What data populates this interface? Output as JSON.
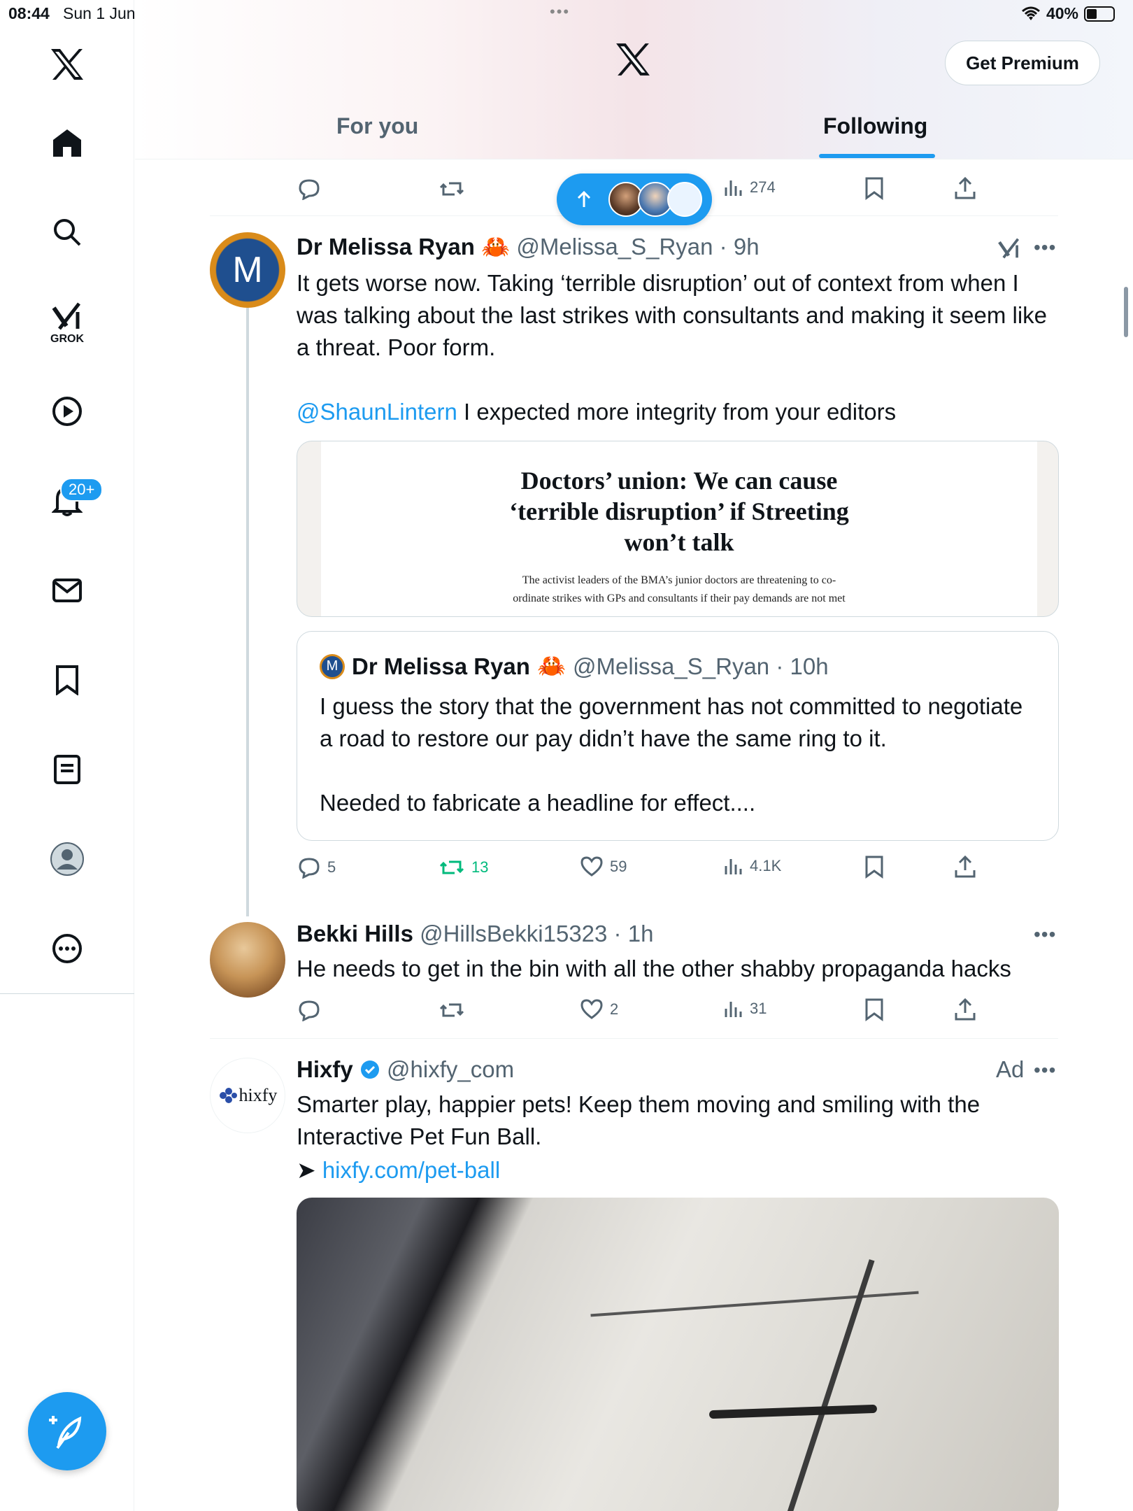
{
  "status_bar": {
    "time": "08:44",
    "date": "Sun 1 Jun",
    "battery": "40%",
    "battery_level": 0.4
  },
  "sidebar": {
    "items": [
      {
        "icon": "home-icon"
      },
      {
        "icon": "search-icon"
      },
      {
        "icon": "grok-icon",
        "label": "GROK"
      },
      {
        "icon": "video-icon"
      },
      {
        "icon": "bell-icon",
        "badge": "20+"
      },
      {
        "icon": "mail-icon"
      },
      {
        "icon": "bookmark-icon"
      },
      {
        "icon": "lists-icon"
      },
      {
        "icon": "profile-icon"
      },
      {
        "icon": "more-icon"
      }
    ],
    "compose": "compose-icon"
  },
  "header": {
    "premium_label": "Get Premium",
    "tabs": [
      {
        "label": "For you",
        "active": false
      },
      {
        "label": "Following",
        "active": true
      }
    ]
  },
  "top_actions": {
    "views": "274"
  },
  "tweet1": {
    "name": "Dr Melissa Ryan",
    "emoji": "🦀",
    "handle": "@Melissa_S_Ryan",
    "time": "9h",
    "text": "It gets worse now. Taking ‘terrible disruption’ out of context from when I was talking about the last strikes with consultants and making it seem like a threat. Poor form.",
    "mention": "@ShaunLintern",
    "text2": " I expected more integrity from your editors",
    "card": {
      "headline": "Doctors’ union: We can cause ‘terrible disruption’ if Streeting won’t talk",
      "subline": "The activist leaders of the BMA’s junior doctors are threatening to co-ordinate strikes with GPs and consultants if their pay demands are not met"
    },
    "quote": {
      "avatar_letter": "M",
      "name": "Dr Melissa Ryan",
      "emoji": "🦀",
      "handle": "@Melissa_S_Ryan",
      "time": "10h",
      "text": "I guess the story that the government has not committed to negotiate a road to restore our pay didn’t have the same ring to it.",
      "text2": "Needed to fabricate a headline for effect...."
    },
    "avatar_letter": "M",
    "stats": {
      "replies": "5",
      "reposts": "13",
      "likes": "59",
      "views": "4.1K"
    }
  },
  "tweet2": {
    "name": "Bekki Hills",
    "handle": "@HillsBekki15323",
    "time": "1h",
    "text": "He needs to get in the bin with all the other shabby propaganda hacks",
    "stats": {
      "likes": "2",
      "views": "31"
    }
  },
  "tweet3": {
    "name": "Hixfy",
    "verified": true,
    "handle": "@hixfy_com",
    "ad_label": "Ad",
    "avatar_text": "hixfy",
    "text": "Smarter play, happier pets! Keep them moving and smiling with the Interactive Pet Fun Ball.",
    "arrow": "➤",
    "link": "hixfy.com/pet-ball"
  },
  "colors": {
    "accent": "#1d9bf0",
    "repost_active": "#00ba7c",
    "text": "#0f1419",
    "muted": "#536471"
  }
}
